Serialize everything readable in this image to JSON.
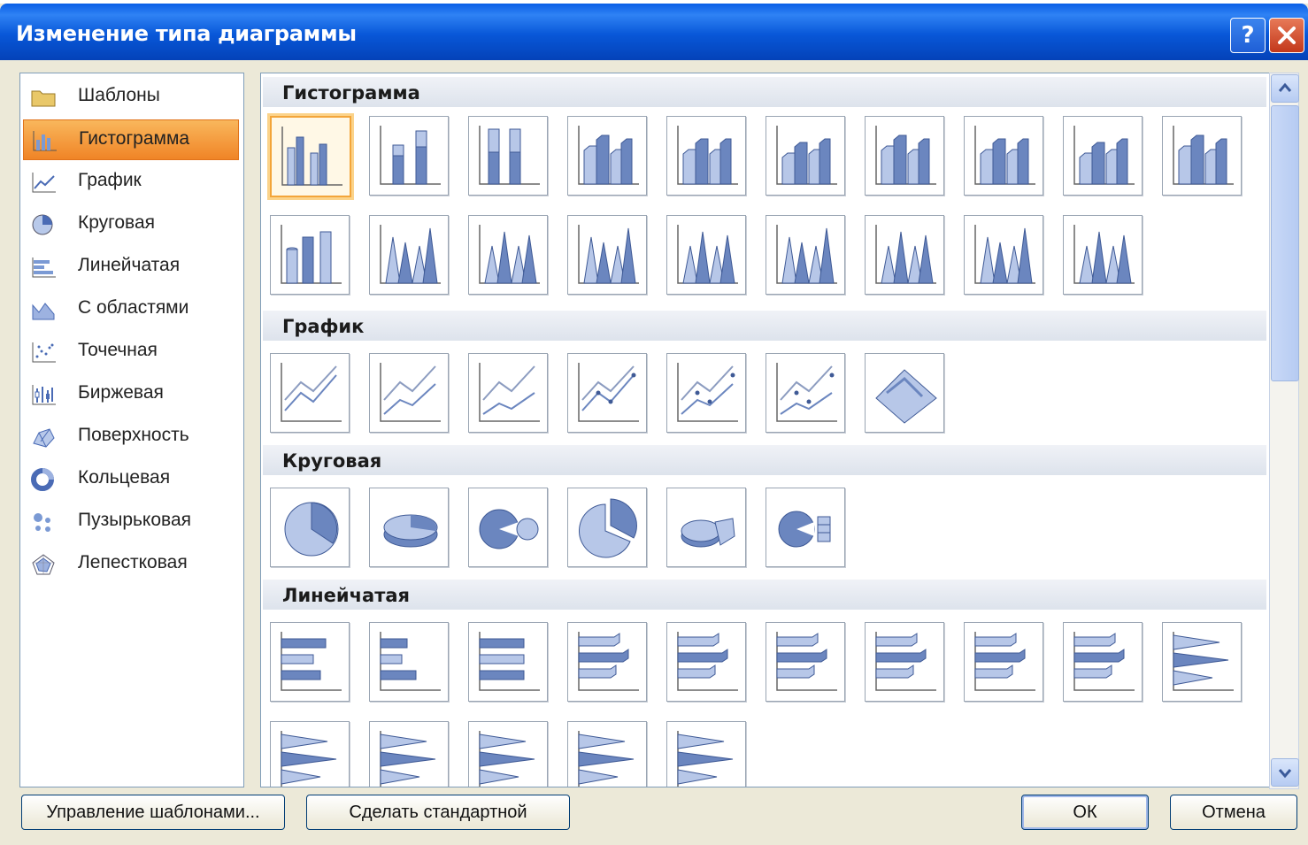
{
  "window": {
    "title": "Изменение типа диаграммы"
  },
  "sidebar": {
    "items": [
      {
        "label": "Шаблоны",
        "icon": "folder-icon",
        "selected": false
      },
      {
        "label": "Гистограмма",
        "icon": "column-chart-icon",
        "selected": true
      },
      {
        "label": "График",
        "icon": "line-chart-icon",
        "selected": false
      },
      {
        "label": "Круговая",
        "icon": "pie-chart-icon",
        "selected": false
      },
      {
        "label": "Линейчатая",
        "icon": "bar-chart-icon",
        "selected": false
      },
      {
        "label": "С областями",
        "icon": "area-chart-icon",
        "selected": false
      },
      {
        "label": "Точечная",
        "icon": "scatter-chart-icon",
        "selected": false
      },
      {
        "label": "Биржевая",
        "icon": "stock-chart-icon",
        "selected": false
      },
      {
        "label": "Поверхность",
        "icon": "surface-chart-icon",
        "selected": false
      },
      {
        "label": "Кольцевая",
        "icon": "doughnut-chart-icon",
        "selected": false
      },
      {
        "label": "Пузырьковая",
        "icon": "bubble-chart-icon",
        "selected": false
      },
      {
        "label": "Лепестковая",
        "icon": "radar-chart-icon",
        "selected": false
      }
    ]
  },
  "gallery": {
    "sections": [
      {
        "title": "Гистограмма",
        "count": 19
      },
      {
        "title": "График",
        "count": 7
      },
      {
        "title": "Круговая",
        "count": 6
      },
      {
        "title": "Линейчатая",
        "count": 15
      }
    ]
  },
  "buttons": {
    "manage_templates": "Управление шаблонами...",
    "set_default": "Сделать стандартной",
    "ok": "ОК",
    "cancel": "Отмена"
  },
  "colors": {
    "title_bar": "#0a5fe6",
    "selection": "#f08426",
    "chart_fill": "#6b86bf",
    "dialog_bg": "#ece9d8"
  }
}
